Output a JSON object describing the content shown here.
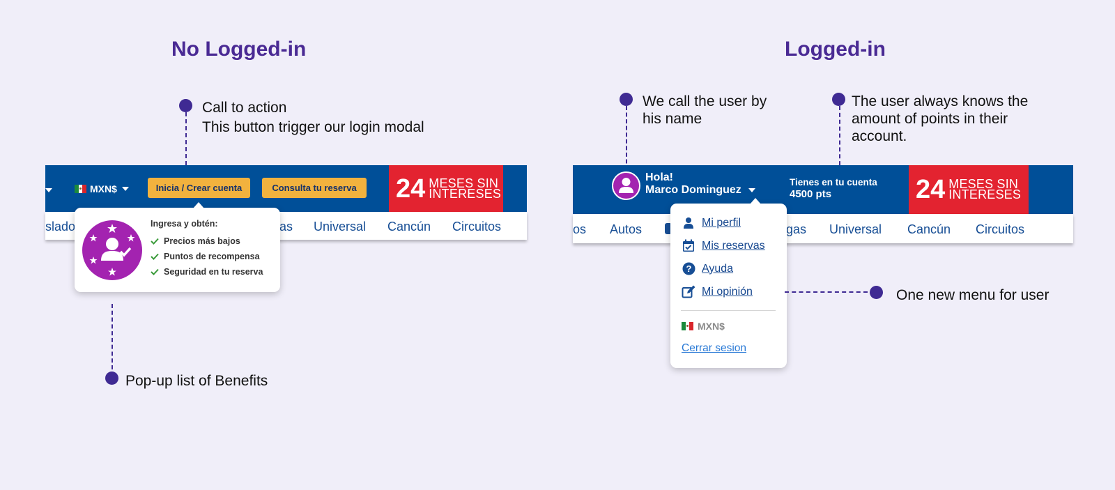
{
  "titles": {
    "left": "No Logged-in",
    "right": "Logged-in"
  },
  "annotations": {
    "cta": [
      "Call to action",
      "This button trigger our login modal"
    ],
    "benefits": "Pop-up list of Benefits",
    "username": [
      "We call the user by",
      "his name"
    ],
    "points": [
      "The user always knows the",
      "amount of points in their",
      "account."
    ],
    "menu": "One new menu for user"
  },
  "left_nav": {
    "currency": "MXN$",
    "login_button": "Inicia / Crear cuenta",
    "booking_button": "Consulta tu reserva",
    "promo_number": "24",
    "promo_text": [
      "MESES SIN",
      "INTERESES"
    ],
    "links": [
      "slado",
      "as",
      "Universal",
      "Cancún",
      "Circuitos"
    ]
  },
  "benefits_popup": {
    "title": "Ingresa y obtén:",
    "items": [
      "Precios más bajos",
      "Puntos de recompensa",
      "Seguridad en tu reserva"
    ]
  },
  "right_nav": {
    "greeting": "Hola!",
    "user_name": "Marco Dominguez",
    "points_label": "Tienes en tu cuenta",
    "points_value": "4500 pts",
    "promo_number": "24",
    "promo_text": [
      "MESES SIN",
      "INTERESES"
    ],
    "links": [
      "os",
      "Autos",
      "gas",
      "Universal",
      "Cancún",
      "Circuitos"
    ]
  },
  "user_menu": {
    "items": [
      {
        "label": "Mi perfil",
        "icon": "user-icon"
      },
      {
        "label": "Mis reservas",
        "icon": "calendar-check-icon"
      },
      {
        "label": "Ayuda",
        "icon": "question-circle-icon"
      },
      {
        "label": "Mi opinión",
        "icon": "edit-icon"
      }
    ],
    "currency": "MXN$",
    "logout": "Cerrar sesion"
  },
  "colors": {
    "background": "#f0eef9",
    "title": "#4a2a94",
    "annotation_dot": "#3f2a93",
    "nav_blue": "#004f98",
    "button_yellow": "#f2b23e",
    "promo_red": "#e32330",
    "avatar_purple": "#a323b0",
    "check_green": "#3a9b3a"
  }
}
